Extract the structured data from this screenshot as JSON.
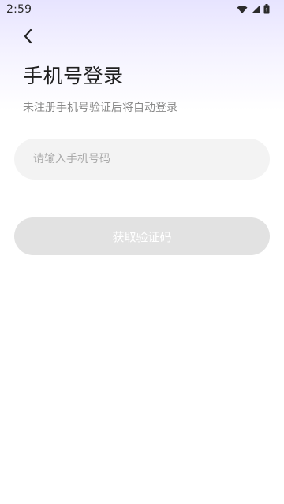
{
  "status_bar": {
    "time": "2:59",
    "icons": [
      "wifi-icon",
      "signal-icon",
      "battery-icon"
    ]
  },
  "header": {
    "back_icon": "chevron-left-icon"
  },
  "login": {
    "title": "手机号登录",
    "subtitle": "未注册手机号验证后将自动登录",
    "phone_input": {
      "placeholder": "请输入手机号码",
      "value": ""
    },
    "get_code_label": "获取验证码"
  },
  "colors": {
    "gradient_top": "#e7e4ff",
    "input_bg": "#f3f3f3",
    "button_disabled_bg": "#e2e2e2",
    "subtitle_text": "#8a8a8a"
  }
}
